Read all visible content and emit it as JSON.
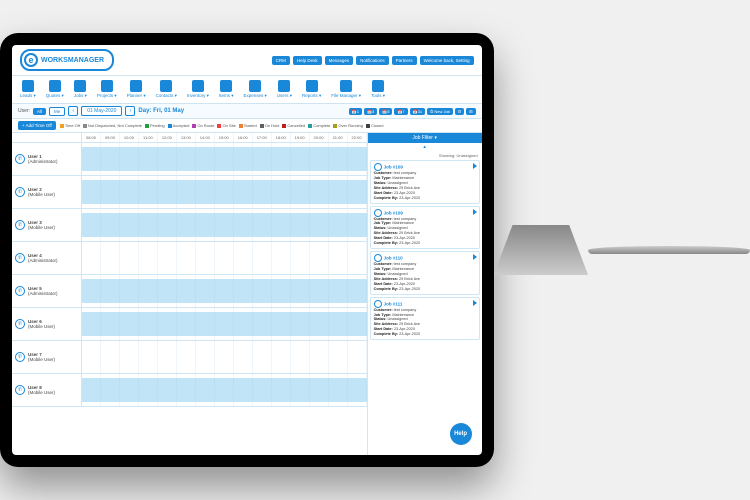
{
  "brand": {
    "e": "e",
    "name": "WORKSMANAGER"
  },
  "topLinks": [
    "CRM",
    "Help Desk",
    "Messages",
    "Notifications",
    "Partners",
    "Welcome back, Setting"
  ],
  "mainNav": [
    "Leads",
    "Quotes",
    "Jobs",
    "Projects",
    "Planner",
    "Contacts",
    "Inventory",
    "Items",
    "Expenses",
    "Users",
    "Reports",
    "File Manager",
    "Tools"
  ],
  "control": {
    "userLabel": "User:",
    "all": "All",
    "me": "Me",
    "dateText": "01 May-2020",
    "dayLabel": "Day: Fri, 01 May"
  },
  "viewPills": [
    "1",
    "3",
    "5",
    "7",
    "31"
  ],
  "newJobLabel": "New Job",
  "addTimeOff": "+ Add Time Off",
  "legend": [
    {
      "label": "Time Off",
      "color": "#f0a020"
    },
    {
      "label": "Not Dispatched, Not Complete",
      "color": "#888"
    },
    {
      "label": "Pending",
      "color": "#20a040"
    },
    {
      "label": "Accepted",
      "color": "#1a88d8"
    },
    {
      "label": "On Route",
      "color": "#b040b0"
    },
    {
      "label": "On Site",
      "color": "#f04040"
    },
    {
      "label": "Started",
      "color": "#f08030"
    },
    {
      "label": "On Hold",
      "color": "#606060"
    },
    {
      "label": "Cancelled",
      "color": "#c02020"
    },
    {
      "label": "Complete",
      "color": "#20a0a0"
    },
    {
      "label": "Over Running",
      "color": "#a0a020"
    },
    {
      "label": "Closed",
      "color": "#404040"
    }
  ],
  "times": [
    "08:00",
    "09:00",
    "10:00",
    "11:00",
    "12:00",
    "13:00",
    "14:00",
    "15:00",
    "16:00",
    "17:00",
    "18:00",
    "19:00",
    "20:00",
    "21:00",
    "22:00"
  ],
  "users": [
    {
      "name": "User 1",
      "role": "(Administrator)",
      "bar": [
        0,
        100
      ]
    },
    {
      "name": "User 2",
      "role": "(Mobile User)",
      "bar": [
        0,
        100
      ]
    },
    {
      "name": "User 3",
      "role": "(Mobile User)",
      "bar": [
        0,
        100
      ]
    },
    {
      "name": "User 4",
      "role": "(Administrator)",
      "bar": null
    },
    {
      "name": "User 5",
      "role": "(Administrator)",
      "bar": [
        0,
        100
      ]
    },
    {
      "name": "User 6",
      "role": "(Mobile User)",
      "bar": [
        0,
        100
      ]
    },
    {
      "name": "User 7",
      "role": "(Mobile User)",
      "bar": null
    },
    {
      "name": "User 8",
      "role": "(Mobile User)",
      "bar": [
        0,
        100
      ]
    }
  ],
  "sidePanel": {
    "header": "Job Filter ▾",
    "showing": "Showing: Unassigned",
    "cards": [
      {
        "id": "Job #109",
        "customer": "test company",
        "jobType": "Maintenance",
        "status": "Unassigned",
        "siteAddress": "29 Brick Ave",
        "startDate": "23-Apr-2020",
        "completeBy": "23-Apr-2020"
      },
      {
        "id": "Job #109",
        "customer": "test company",
        "jobType": "Maintenance",
        "status": "Unassigned",
        "siteAddress": "29 Brick Ave",
        "startDate": "23-Apr-2020",
        "completeBy": "23-Apr-2020"
      },
      {
        "id": "Job #110",
        "customer": "test company",
        "jobType": "Maintenance",
        "status": "Unassigned",
        "siteAddress": "29 Brick Ave",
        "startDate": "23-Apr-2020",
        "completeBy": "23-Apr-2020"
      },
      {
        "id": "Job #111",
        "customer": "test company",
        "jobType": "Maintenance",
        "status": "Unassigned",
        "siteAddress": "29 Brick Ave",
        "startDate": "23-Apr-2020",
        "completeBy": "23-Apr-2020"
      }
    ]
  },
  "help": "Help",
  "fieldLabels": {
    "customer": "Customer:",
    "jobType": "Job Type:",
    "status": "Status:",
    "siteAddress": "Site Address:",
    "startDate": "Start Date:",
    "completeBy": "Complete By:"
  }
}
